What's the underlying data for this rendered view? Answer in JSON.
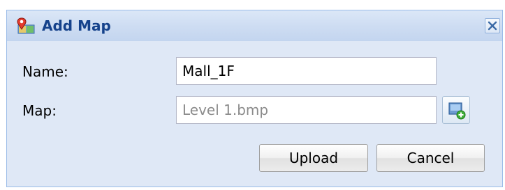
{
  "dialog": {
    "title": "Add Map",
    "title_icon": "map-pin-icon",
    "close_icon": "close-icon"
  },
  "form": {
    "name_label": "Name:",
    "name_value": "Mall_1F",
    "map_label": "Map:",
    "map_placeholder": "Level 1.bmp",
    "browse_icon": "add-image-icon"
  },
  "buttons": {
    "upload_label": "Upload",
    "cancel_label": "Cancel"
  },
  "colors": {
    "title_text": "#15428b",
    "panel_background": "#dfe8f6",
    "border": "#99bbe8"
  }
}
